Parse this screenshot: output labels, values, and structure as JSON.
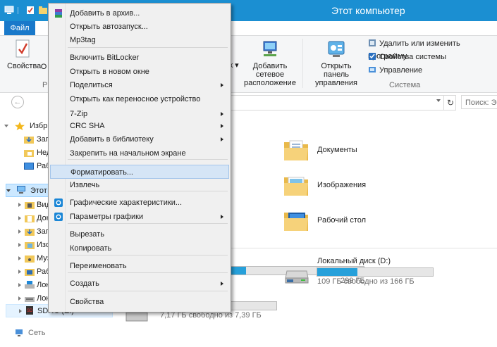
{
  "window": {
    "title": "Этот компьютер"
  },
  "tabs": {
    "file": "Файл"
  },
  "ribbon": {
    "properties": "Свойства",
    "partial_o": "О",
    "partial_r": "Р",
    "partial_k": "к ▾",
    "add_network": "Добавить сетевое расположение",
    "open_control": "Открыть панель управления",
    "uninstall": "Удалить или изменить программу",
    "sys_props": "Свойства системы",
    "manage": "Управление",
    "group_system": "Система"
  },
  "nav": {
    "back": "←",
    "refresh": "↻",
    "search_placeholder": "Поиск: Э"
  },
  "tree": {
    "favorites": "Избр",
    "fav1": "Заг",
    "fav2": "Нед",
    "fav3": "Раб",
    "this_pc": "Этот",
    "pc1": "Вид",
    "pc2": "Док",
    "pc3": "Заг",
    "pc4": "Изо",
    "pc5": "Муз",
    "pc6": "Раб",
    "pc7": "Лок",
    "pc8": "Лок",
    "pc9": "SDHC (E:)",
    "network": "Сеть"
  },
  "content": {
    "folders": [
      "Документы",
      "Изображения",
      "Рабочий стол"
    ],
    "drive_c_free": "299 ГБ",
    "drive_d_name": "Локальный диск (D:)",
    "drive_d_free": "109 ГБ свободно из 166 ГБ",
    "drive_e_free": "7,17 ГБ свободно из 7,39 ГБ",
    "drive_d_fill": 0.35,
    "drive_c_fill": 0.12,
    "drive_e_fill": 0.03
  },
  "menu": {
    "items": [
      {
        "label": "Добавить в архив...",
        "icon": "winrar-icon"
      },
      {
        "label": "Открыть автозапуск...",
        "icon": ""
      },
      {
        "label": "Mp3tag",
        "icon": ""
      },
      {
        "label": "Включить BitLocker",
        "icon": ""
      },
      {
        "label": "Открыть в новом окне",
        "icon": ""
      },
      {
        "label": "Поделиться",
        "icon": "",
        "sub": true
      },
      {
        "label": "Открыть как переносное устройство",
        "icon": ""
      },
      {
        "label": "7-Zip",
        "icon": "",
        "sub": true
      },
      {
        "label": "CRC SHA",
        "icon": "",
        "sub": true
      },
      {
        "label": "Добавить в библиотеку",
        "icon": "",
        "sub": true
      },
      {
        "label": "Закрепить на начальном экране",
        "icon": ""
      },
      {
        "label": "Форматировать...",
        "icon": ""
      },
      {
        "label": "Извлечь",
        "icon": ""
      },
      {
        "label": "Графические характеристики...",
        "icon": "intel-graphics-icon"
      },
      {
        "label": "Параметры графики",
        "icon": "intel-graphics-icon",
        "sub": true
      },
      {
        "label": "Вырезать",
        "icon": ""
      },
      {
        "label": "Копировать",
        "icon": ""
      },
      {
        "label": "Переименовать",
        "icon": ""
      },
      {
        "label": "Создать",
        "icon": "",
        "sub": true
      },
      {
        "label": "Свойства",
        "icon": ""
      }
    ]
  },
  "colors": {
    "titlebar": "#1b8fd2",
    "file_tab": "#1979ca",
    "menu_highlight": "#d5e5f6",
    "drive_bar": "#26a0da"
  }
}
